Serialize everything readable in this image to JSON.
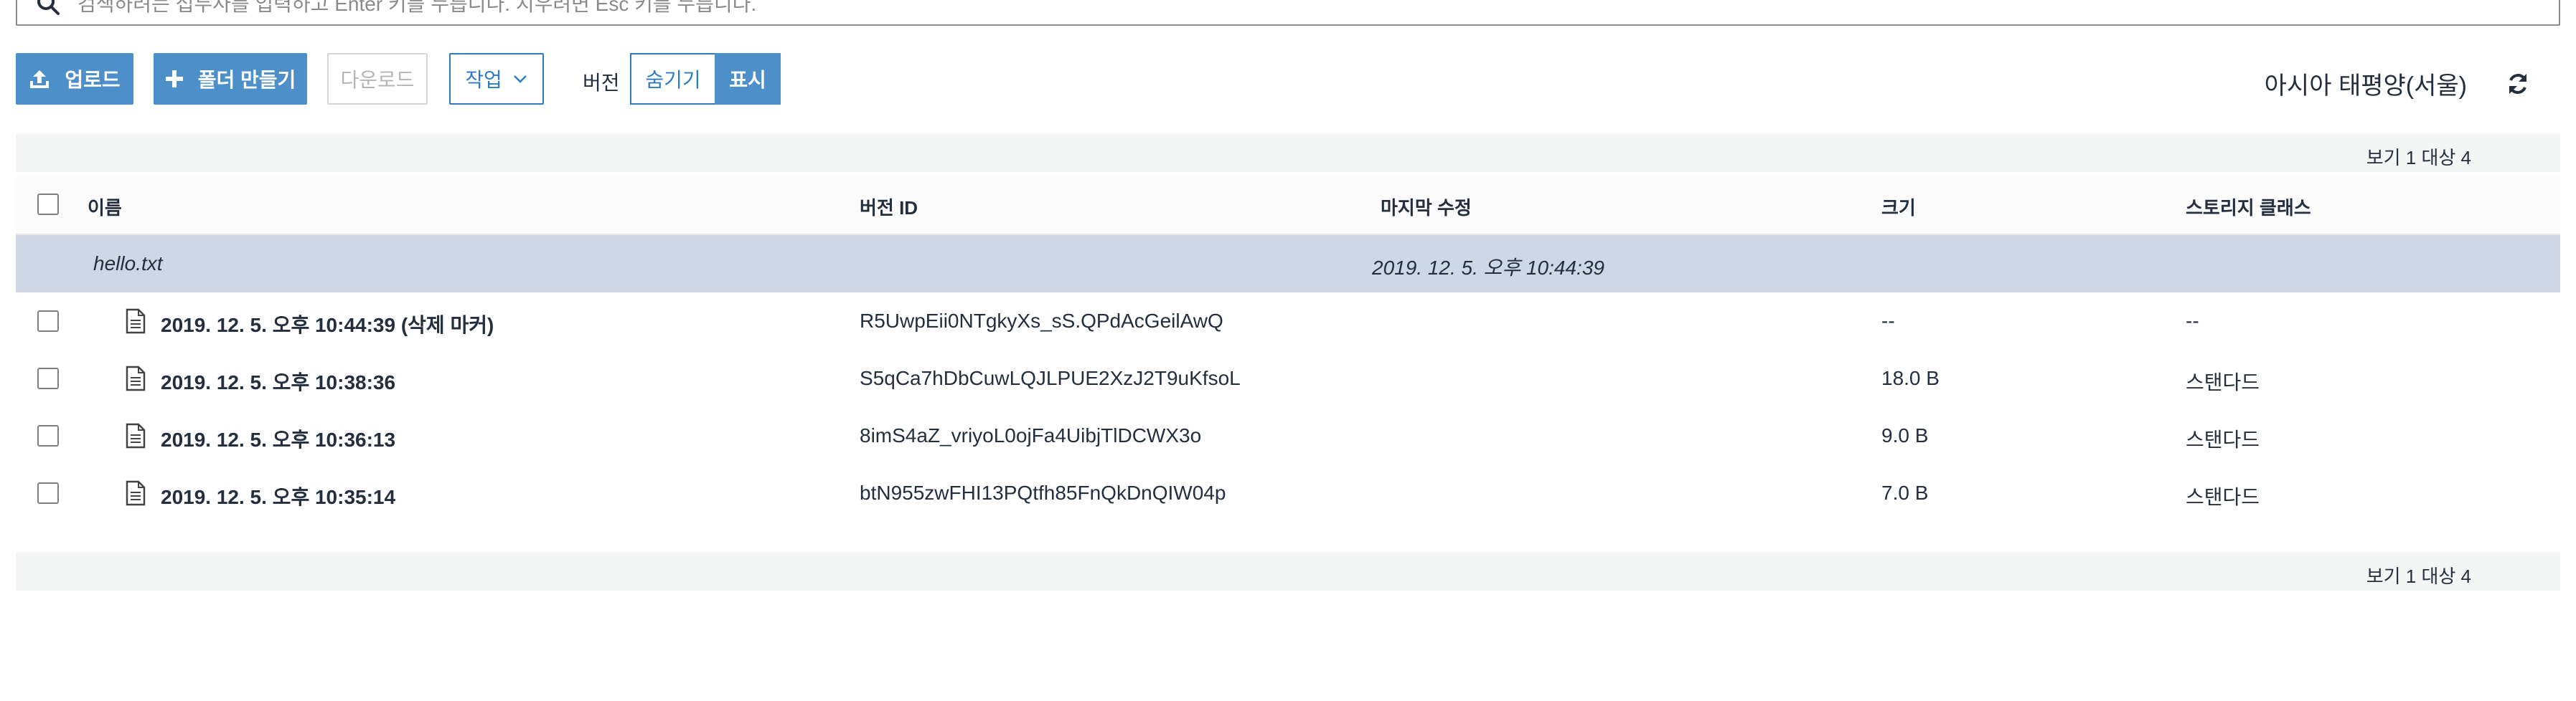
{
  "search": {
    "placeholder": "검색하려는 접두사를 입력하고 Enter 키를 누릅니다. 지우려면 Esc 키를 누릅니다."
  },
  "toolbar": {
    "upload_label": "업로드",
    "create_folder_label": "폴더 만들기",
    "download_label": "다운로드",
    "actions_label": "작업",
    "version_label": "버전",
    "hide_label": "숨기기",
    "show_label": "표시",
    "region": "아시아 태평양(서울)"
  },
  "pager": {
    "top": "보기 1 대상 4",
    "bottom": "보기 1 대상 4"
  },
  "table": {
    "columns": {
      "name": "이름",
      "version_id": "버전 ID",
      "last_modified": "마지막 수정",
      "size": "크기",
      "storage_class": "스토리지 클래스"
    },
    "group": {
      "name": "hello.txt",
      "last_modified": "2019. 12. 5. 오후 10:44:39"
    },
    "rows": [
      {
        "name": "2019. 12. 5. 오후 10:44:39 (삭제 마커)",
        "version_id": "R5UwpEii0NTgkyXs_sS.QPdAcGeilAwQ",
        "size": "--",
        "storage_class": "--"
      },
      {
        "name": "2019. 12. 5. 오후 10:38:36",
        "version_id": "S5qCa7hDbCuwLQJLPUE2XzJ2T9uKfsoL",
        "size": "18.0 B",
        "storage_class": "스탠다드"
      },
      {
        "name": "2019. 12. 5. 오후 10:36:13",
        "version_id": "8imS4aZ_vriyoL0ojFa4UibjTlDCWX3o",
        "size": "9.0 B",
        "storage_class": "스탠다드"
      },
      {
        "name": "2019. 12. 5. 오후 10:35:14",
        "version_id": "btN955zwFHI13PQtfh85FnQkDnQIW04p",
        "size": "7.0 B",
        "storage_class": "스탠다드"
      }
    ]
  },
  "icons": {
    "search": "search-icon",
    "upload": "upload-icon",
    "plus": "plus-icon",
    "chevron": "chevron-down-icon",
    "refresh": "refresh-icon",
    "file": "file-icon"
  },
  "colors": {
    "primary": "#4d8fc9",
    "outline": "#2f7bc0",
    "group_row": "#cdd8e4",
    "pager_bg": "#f4f5f5"
  }
}
